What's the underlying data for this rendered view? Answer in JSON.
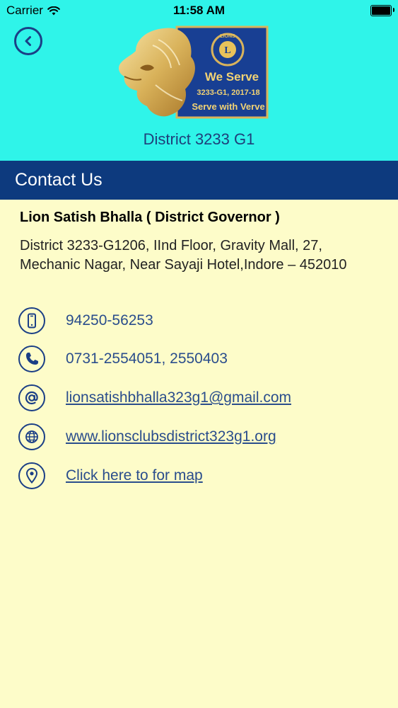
{
  "status_bar": {
    "carrier": "Carrier",
    "time": "11:58 AM"
  },
  "header": {
    "logo": {
      "badge_text": "LIONS",
      "emblem_letter": "L",
      "tagline": "We Serve",
      "district_year": "3233-G1, 2017-18",
      "motto": "Serve with Verve"
    },
    "district_title": "District 3233 G1"
  },
  "section": {
    "title": "Contact Us"
  },
  "contact": {
    "name": "Lion Satish Bhalla ( District Governor )",
    "address": "District 3233-G1206, IInd Floor, Gravity Mall, 27, Mechanic Nagar, Near Sayaji Hotel,Indore – 452010",
    "mobile": "94250-56253",
    "phone": "0731-2554051, 2550403",
    "email": "lionsatishbhalla323g1@gmail.com",
    "website": "www.lionsclubsdistrict323g1.org",
    "map_link": "Click here to for map"
  },
  "colors": {
    "header_bg": "#2ff4e9",
    "section_bar_bg": "#0d3a7e",
    "page_bg": "#fdfcc9",
    "icon_accent": "#1b3f86",
    "link_text": "#2a4d8c"
  },
  "icons": {
    "back": "chevron-left-icon",
    "mobile": "mobile-phone-icon",
    "phone": "phone-handset-icon",
    "email": "at-sign-icon",
    "website": "globe-icon",
    "map": "map-pin-icon"
  }
}
